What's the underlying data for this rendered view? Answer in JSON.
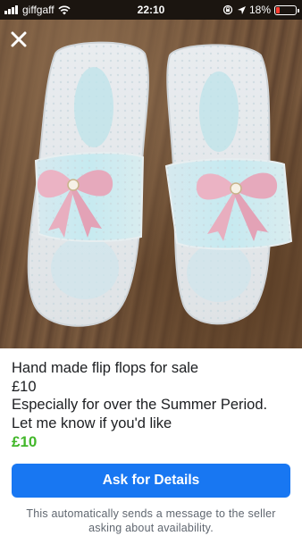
{
  "status_bar": {
    "carrier": "giffgaff",
    "time": "22:10",
    "battery": "18%",
    "battery_level": 0.18,
    "battery_color": "#ff3b30"
  },
  "photo": {
    "subject": "handmade flip flops with pink bows"
  },
  "listing": {
    "description_lines": [
      "Hand made flip flops for sale",
      "£10",
      "Especially for over the Summer Period.",
      "Let me know if you'd like"
    ],
    "price": "£10",
    "price_color": "#42b72a"
  },
  "actions": {
    "cta_label": "Ask for Details",
    "cta_color": "#1877f2",
    "footnote_lines": [
      "This automatically sends a message to the seller",
      "asking about availability."
    ]
  }
}
